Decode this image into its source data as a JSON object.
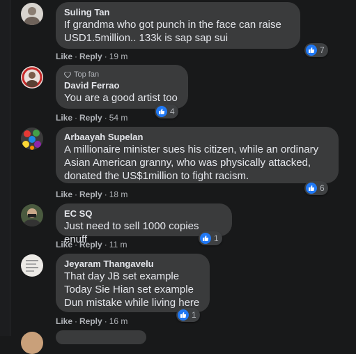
{
  "actions": {
    "like": "Like",
    "reply": "Reply",
    "dot": "·"
  },
  "comments": [
    {
      "author": "Suling Tan",
      "badge": "",
      "text": "If grandma who got punch in the face can raise\nUSD1.5million.. 133k is sap sap sui",
      "time": "19 m",
      "reactions": "7"
    },
    {
      "author": "David Ferrao",
      "badge": "Top fan",
      "text": "You are a good artist too",
      "time": "54 m",
      "reactions": "4"
    },
    {
      "author": "Arbaayah Supelan",
      "badge": "",
      "text": "A millionaire minister sues his citizen, while an ordinary\nAsian American granny, who was physically attacked,\ndonated the US$1million to fight racism.",
      "time": "18 m",
      "reactions": "6"
    },
    {
      "author": "EC SQ",
      "badge": "",
      "text": "Just need to sell 1000 copies enuff",
      "time": "11 m",
      "reactions": "1"
    },
    {
      "author": "Jeyaram Thangavelu",
      "badge": "",
      "text": "That day JB set example\nToday Sie Hian set example\nDun mistake while living here",
      "time": "16 m",
      "reactions": "1"
    }
  ],
  "colors": {
    "bubble": "#3a3b3c",
    "background": "#18191a",
    "like_blue": "#2078f4"
  }
}
